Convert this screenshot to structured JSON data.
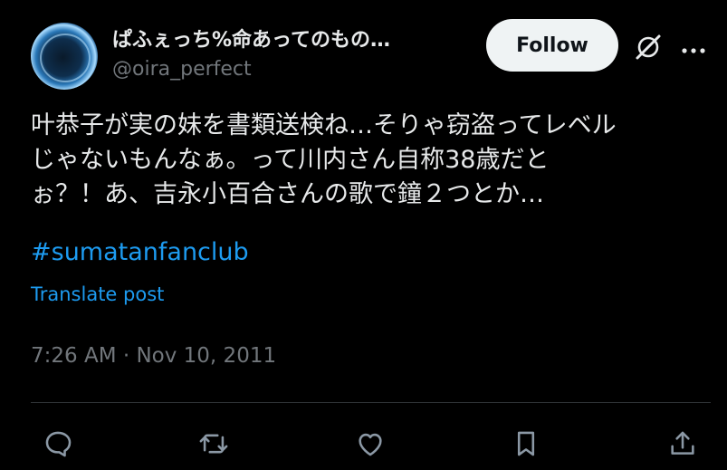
{
  "author": {
    "display_name": "ぱふぇっち%命あってのもの…",
    "handle": "@oira_perfect",
    "avatar_icon": "avatar-planet-ring"
  },
  "header": {
    "follow_label": "Follow",
    "grok_icon": "grok-icon",
    "more_icon": "more-icon"
  },
  "tweet": {
    "lines": [
      "叶恭子が実の妹を書類送検ね…そりゃ窃盗ってレベル",
      "じゃないもんなぁ。って川内さん自称38歳だと",
      "ぉ？！あ、吉永小百合さんの歌で鐘２つとか…"
    ],
    "hashtag": "#sumatanfanclub",
    "translate_label": "Translate post",
    "timestamp": "7:26 AM · Nov 10, 2011"
  },
  "actions": [
    "reply-icon",
    "retweet-icon",
    "like-icon",
    "bookmark-icon",
    "share-icon"
  ],
  "colors": {
    "background": "#000000",
    "text": "#e7e9ea",
    "muted": "#71767b",
    "link": "#1d9bf0",
    "follow_bg": "#eff3f4",
    "divider": "#2f3336"
  }
}
